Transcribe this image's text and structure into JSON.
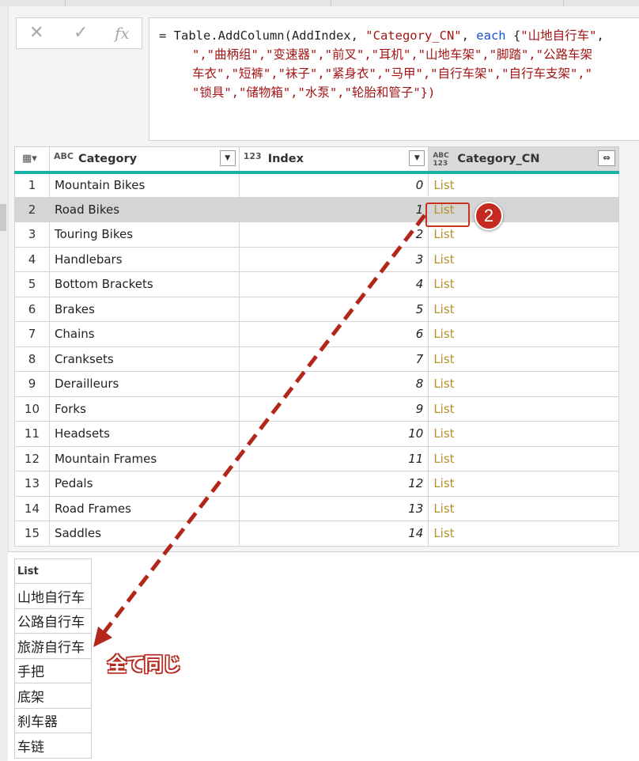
{
  "formula_bar": {
    "cancel_icon": "close-icon",
    "confirm_icon": "check-icon",
    "fx_label": "fx",
    "line1": [
      {
        "t": "= Table.AddColumn(AddIndex, ",
        "c": "plain"
      },
      {
        "t": "\"Category_CN\"",
        "c": "str"
      },
      {
        "t": ", ",
        "c": "plain"
      },
      {
        "t": "each",
        "c": "kw"
      },
      {
        "t": " {",
        "c": "plain"
      },
      {
        "t": "\"山地自行车\"",
        "c": "str"
      },
      {
        "t": ",",
        "c": "plain"
      }
    ],
    "line2": "\",\"曲柄组\",\"变速器\",\"前叉\",\"耳机\",\"山地车架\",\"脚踏\",\"公路车架",
    "line3": "车衣\",\"短裤\",\"袜子\",\"紧身衣\",\"马甲\",\"自行车架\",\"自行车支架\",\"",
    "line4": "\"锁具\",\"储物箱\",\"水泵\",\"轮胎和管子\"})"
  },
  "table": {
    "columns": [
      {
        "type_icon": "ABC",
        "label": "Category",
        "filter_icon": "filter-dropdown-icon"
      },
      {
        "type_icon": "123",
        "label": "Index",
        "filter_icon": "filter-dropdown-icon"
      },
      {
        "type_icon": "ABC 123",
        "label": "Category_CN",
        "filter_icon": "expand-icon"
      }
    ],
    "rows": [
      {
        "n": "1",
        "category": "Mountain Bikes",
        "index": "0",
        "cn": "List"
      },
      {
        "n": "2",
        "category": "Road Bikes",
        "index": "1",
        "cn": "List"
      },
      {
        "n": "3",
        "category": "Touring Bikes",
        "index": "2",
        "cn": "List"
      },
      {
        "n": "4",
        "category": "Handlebars",
        "index": "3",
        "cn": "List"
      },
      {
        "n": "5",
        "category": "Bottom Brackets",
        "index": "4",
        "cn": "List"
      },
      {
        "n": "6",
        "category": "Brakes",
        "index": "5",
        "cn": "List"
      },
      {
        "n": "7",
        "category": "Chains",
        "index": "6",
        "cn": "List"
      },
      {
        "n": "8",
        "category": "Cranksets",
        "index": "7",
        "cn": "List"
      },
      {
        "n": "9",
        "category": "Derailleurs",
        "index": "8",
        "cn": "List"
      },
      {
        "n": "10",
        "category": "Forks",
        "index": "9",
        "cn": "List"
      },
      {
        "n": "11",
        "category": "Headsets",
        "index": "10",
        "cn": "List"
      },
      {
        "n": "12",
        "category": "Mountain Frames",
        "index": "11",
        "cn": "List"
      },
      {
        "n": "13",
        "category": "Pedals",
        "index": "12",
        "cn": "List"
      },
      {
        "n": "14",
        "category": "Road Frames",
        "index": "13",
        "cn": "List"
      },
      {
        "n": "15",
        "category": "Saddles",
        "index": "14",
        "cn": "List"
      }
    ],
    "selected_row": 2
  },
  "preview": {
    "header": "List",
    "items": [
      "山地自行车",
      "公路自行车",
      "旅游自行车",
      "手把",
      "底架",
      "刹车器",
      "车链"
    ]
  },
  "annotation": {
    "badge": "2",
    "note": "全て同じ",
    "color": "#c42a1f"
  }
}
